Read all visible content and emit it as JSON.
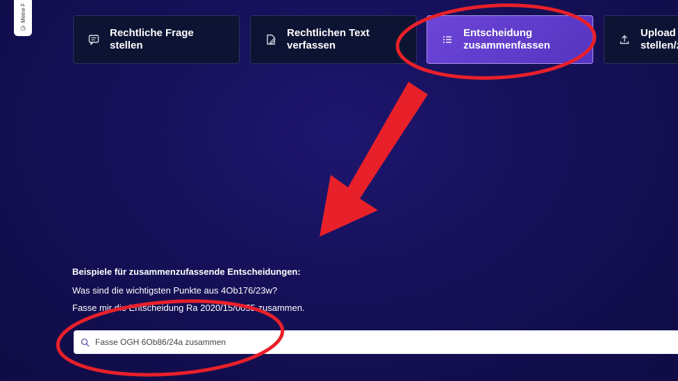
{
  "sidebar": {
    "tab_label": "Meine F"
  },
  "actions": [
    {
      "label": "Rechtliche Frage\nstellen",
      "icon": "chat-icon"
    },
    {
      "label": "Rechtlichen Text\nverfassen",
      "icon": "edit-document-icon"
    },
    {
      "label": "Entscheidung\nzusammenfassen",
      "icon": "list-icon",
      "active": true
    },
    {
      "label": "Upload -\nstellen/z",
      "icon": "upload-icon"
    }
  ],
  "examples": {
    "heading": "Beispiele für zusammenzufassende Entscheidungen:",
    "items": [
      "Was sind die wichtigsten Punkte aus 4Ob176/23w?",
      "Fasse mir die Entscheidung Ra 2020/15/0055 zusammen."
    ]
  },
  "search": {
    "value": "Fasse OGH 6Ob86/24a zusammen"
  },
  "colors": {
    "active_card": "#6d45d8",
    "annotation": "#e8202a",
    "background": "#16115a"
  }
}
